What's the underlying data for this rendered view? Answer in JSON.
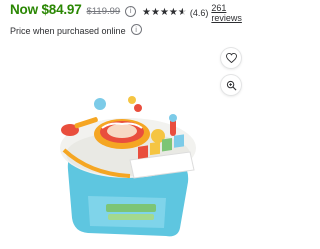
{
  "price": {
    "current": "Now $84.97",
    "was": "$119.99",
    "info_icon": "info-icon"
  },
  "rating": {
    "value": "(4.6)",
    "reviews": "261 reviews",
    "stars": 4.6
  },
  "purchase_note": "Price when purchased online",
  "actions": {
    "favorite_icon": "heart-icon",
    "zoom_icon": "zoom-in-icon"
  },
  "colors": {
    "price_green": "#2a8703",
    "text": "#2e2f32",
    "muted": "#74767c"
  }
}
